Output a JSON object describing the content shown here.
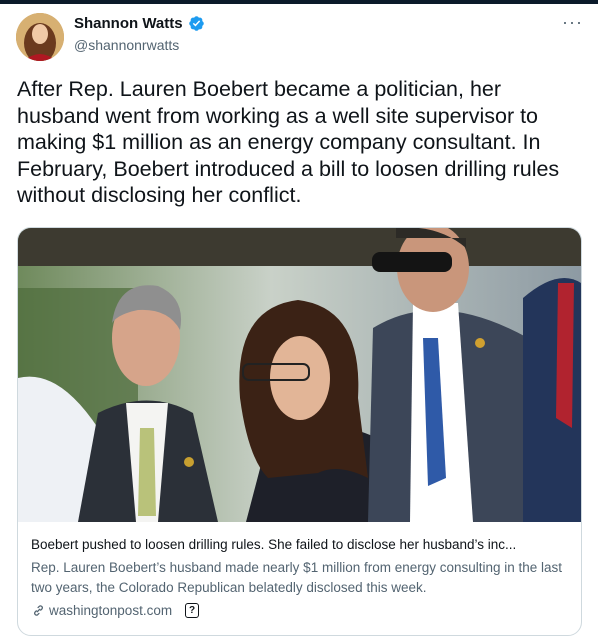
{
  "author": {
    "name": "Shannon Watts",
    "handle": "@shannonrwatts",
    "verified": true,
    "verified_color": "#1d9bf0"
  },
  "menu_label": "···",
  "tweet": {
    "text": "After Rep. Lauren Boebert became a politician, her husband went from working as a well site supervisor to making $1 million as an energy company consultant.  In February, Boebert introduced a bill to loosen drilling rules without disclosing her conflict."
  },
  "card": {
    "title": "Boebert pushed to loosen drilling rules. She failed to disclose her husband’s inc...",
    "description": "Rep. Lauren Boebert’s husband made nearly $1 million from energy consulting in the last two years, the Colorado Republican belatedly disclosed this week.",
    "domain": "washingtonpost.com",
    "info_icon_label": "?"
  },
  "icons": {
    "link": "link-icon",
    "verified": "verified-badge-icon",
    "more": "more-icon",
    "info": "question-icon"
  }
}
